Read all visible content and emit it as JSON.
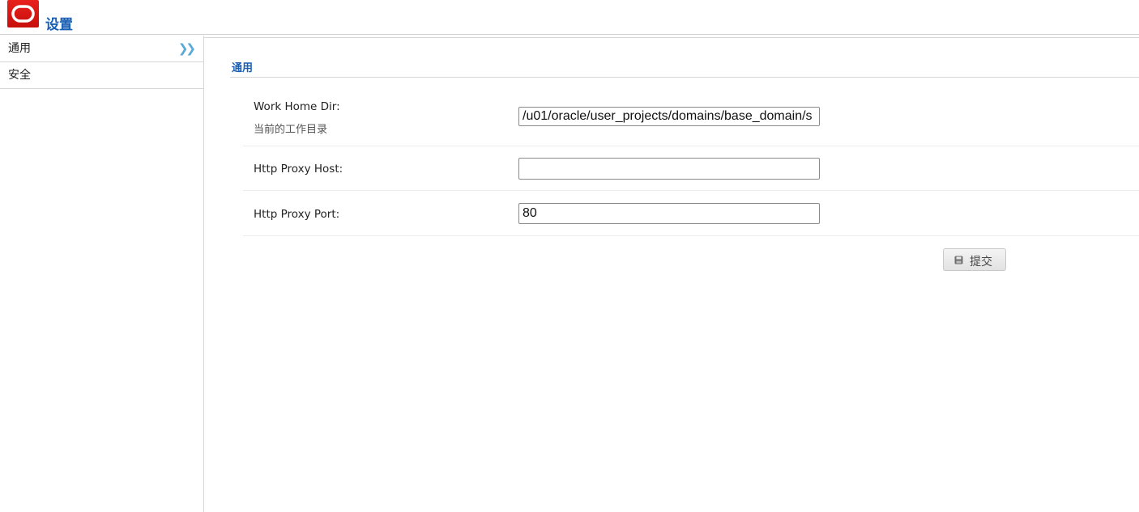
{
  "header": {
    "title": "设置",
    "logo_icon": "oracle-logo"
  },
  "sidebar": {
    "items": [
      {
        "label": "通用",
        "icon": "double-chevron-right-icon"
      },
      {
        "label": "安全"
      }
    ]
  },
  "section": {
    "title": "通用"
  },
  "form": {
    "work_home_dir": {
      "label": "Work Home Dir:",
      "sublabel": "当前的工作目录",
      "value": "/u01/oracle/user_projects/domains/base_domain/s"
    },
    "http_proxy_host": {
      "label": "Http Proxy Host:",
      "value": ""
    },
    "http_proxy_port": {
      "label": "Http Proxy Port:",
      "value": "80"
    }
  },
  "actions": {
    "submit_label": "提交",
    "submit_icon": "save-icon"
  },
  "colors": {
    "accent": "#1a5fb4",
    "logo_red": "#e8201c"
  }
}
